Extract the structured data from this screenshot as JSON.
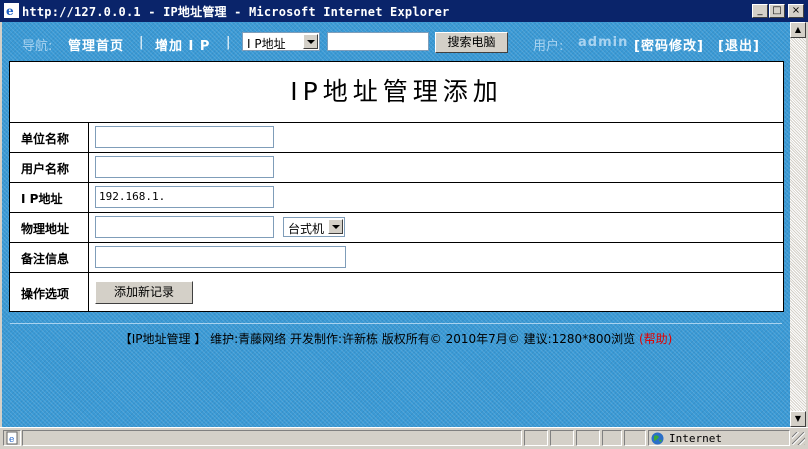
{
  "window": {
    "title": "http://127.0.0.1 - IP地址管理 - Microsoft Internet Explorer",
    "minimize_label": "_",
    "maximize_label": "□",
    "close_label": "×"
  },
  "nav": {
    "prefix": "导航:",
    "home": "管理首页",
    "sep1": "|",
    "add_ip": "增加 I P",
    "sep2": "|",
    "search_field_value": "I P地址",
    "search_input_value": "",
    "search_button": "搜索电脑",
    "user_prefix": "用户:",
    "username": "admin",
    "change_password": "[密码修改]",
    "logout": "[退出]"
  },
  "form": {
    "title": "IP地址管理添加",
    "fields": [
      {
        "label": "单位名称",
        "value": ""
      },
      {
        "label": "用户名称",
        "value": ""
      },
      {
        "label": "I P地址",
        "value": "192.168.1."
      },
      {
        "label": "物理地址",
        "value": ""
      },
      {
        "label": "备注信息",
        "value": ""
      }
    ],
    "device_type": "台式机",
    "action_label": "操作选项",
    "submit_button": "添加新记录"
  },
  "footer": {
    "text": "【IP地址管理 】 维护:青藤网络 开发制作:许新栋 版权所有© 2010年7月©    建议:1280*800浏览",
    "help": "(帮助)"
  },
  "statusbar": {
    "zone": "Internet"
  },
  "colors": {
    "titlebar": "#0a246a",
    "background": "#3a9ad6",
    "help": "#e00000"
  }
}
